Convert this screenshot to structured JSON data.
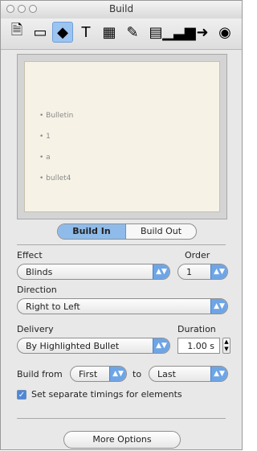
{
  "window": {
    "title": "Build"
  },
  "toolbar": {
    "icons": [
      "document-inspector-icon",
      "slide-inspector-icon",
      "build-inspector-icon",
      "text-inspector-icon",
      "graphic-inspector-icon",
      "metrics-inspector-icon",
      "table-inspector-icon",
      "chart-inspector-icon",
      "hyperlink-inspector-icon",
      "quicktime-inspector-icon"
    ]
  },
  "preview": {
    "bullets": [
      "Bulletin",
      "1",
      "a",
      "bullet4"
    ]
  },
  "build_tabs": {
    "in": "Build In",
    "out": "Build Out"
  },
  "effect": {
    "label": "Effect",
    "value": "Blinds"
  },
  "order": {
    "label": "Order",
    "value": "1"
  },
  "direction": {
    "label": "Direction",
    "value": "Right to Left"
  },
  "delivery": {
    "label": "Delivery",
    "value": "By Highlighted Bullet"
  },
  "duration": {
    "label": "Duration",
    "value": "1.00 s"
  },
  "build_from": {
    "label": "Build from",
    "from": "First",
    "to_label": "to",
    "to": "Last"
  },
  "separate_timings": {
    "label": "Set separate timings for elements",
    "checked": true
  },
  "buttons": {
    "more_options": "More Options"
  }
}
